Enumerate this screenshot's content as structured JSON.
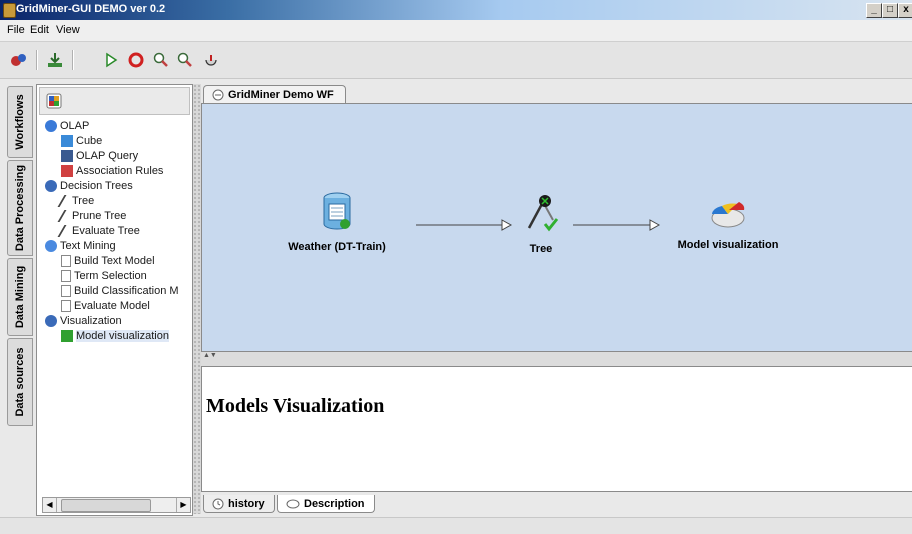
{
  "window": {
    "title": "GridMiner-GUI DEMO ver 0.2"
  },
  "menu": {
    "items": [
      "File",
      "Edit",
      "View"
    ]
  },
  "toolbar": {
    "icons": [
      "workflow-icon",
      "download-icon",
      "play-icon",
      "stop-icon",
      "zoom-in-icon",
      "zoom-out-icon",
      "cursor-icon"
    ]
  },
  "sidebar": {
    "tabs": [
      "Workflows",
      "Data Processing",
      "Data Mining",
      "Data sources"
    ]
  },
  "tree": {
    "nodes": [
      {
        "label": "OLAP",
        "level": 0,
        "icon": "olap-folder-icon"
      },
      {
        "label": "Cube",
        "level": 1,
        "icon": "cube-icon"
      },
      {
        "label": "OLAP Query",
        "level": 1,
        "icon": "olap-query-icon"
      },
      {
        "label": "Association Rules",
        "level": 1,
        "icon": "association-rules-icon"
      },
      {
        "label": "Decision Trees",
        "level": 0,
        "icon": "folder-icon"
      },
      {
        "label": "Tree",
        "level": 1,
        "icon": "tree-tool-icon"
      },
      {
        "label": "Prune Tree",
        "level": 1,
        "icon": "tree-tool-icon"
      },
      {
        "label": "Evaluate Tree",
        "level": 1,
        "icon": "tree-tool-icon"
      },
      {
        "label": "Text Mining",
        "level": 0,
        "icon": "text-mining-folder-icon"
      },
      {
        "label": "Build Text Model",
        "level": 1,
        "icon": "page-icon"
      },
      {
        "label": "Term Selection",
        "level": 1,
        "icon": "page-icon"
      },
      {
        "label": "Build Classification M",
        "level": 1,
        "icon": "page-icon"
      },
      {
        "label": "Evaluate Model",
        "level": 1,
        "icon": "page-icon"
      },
      {
        "label": "Visualization",
        "level": 0,
        "icon": "folder-icon"
      },
      {
        "label": "Model visualization",
        "level": 1,
        "icon": "model-visualization-icon",
        "selected": true
      }
    ]
  },
  "canvas": {
    "tab_label": "GridMiner Demo WF",
    "nodes": [
      {
        "label": "Weather (DT-Train)",
        "icon": "database-icon"
      },
      {
        "label": "Tree",
        "icon": "tree-tool-icon"
      },
      {
        "label": "Model visualization",
        "icon": "pie-chart-icon"
      }
    ]
  },
  "description": {
    "title": "Models Visualization"
  },
  "bottom_tabs": [
    "history",
    "Description"
  ],
  "colors": {
    "canvas_bg": "#c8d9ee",
    "title_bar": "#0a246a"
  }
}
